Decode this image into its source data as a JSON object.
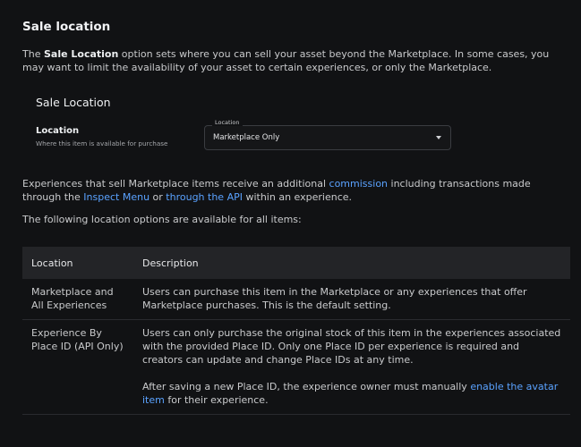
{
  "heading": "Sale location",
  "intro": {
    "prefix": "The ",
    "bold": "Sale Location",
    "suffix": " option sets where you can sell your asset beyond the Marketplace. In some cases, you may want to limit the availability of your asset to certain experiences, or only the Marketplace."
  },
  "card": {
    "title": "Sale Location",
    "location_label": "Location",
    "location_sub": "Where this item is available for purchase",
    "select_float_label": "Location",
    "select_value": "Marketplace Only"
  },
  "commission_para": {
    "t1": "Experiences that sell Marketplace items receive an additional ",
    "link1": "commission",
    "t2": " including transactions made through the ",
    "link2": "Inspect Menu",
    "t3": " or ",
    "link3": "through the API",
    "t4": " within an experience."
  },
  "options_intro": "The following location options are available for all items:",
  "table": {
    "headers": [
      "Location",
      "Description"
    ],
    "rows": [
      {
        "location": "Marketplace and All Experiences",
        "description": "Users can purchase this item in the Marketplace or any experiences that offer Marketplace purchases. This is the default setting."
      },
      {
        "location": "Experience By Place ID (API Only)",
        "description": "Users can only purchase the original stock of this item in the experiences associated with the provided Place ID. Only one Place ID per experience is required and creators can update and change Place IDs at any time.",
        "note_prefix": "After saving a new Place ID, the experience owner must manually ",
        "note_link": "enable the avatar item",
        "note_suffix": " for their experience."
      }
    ]
  },
  "colors": {
    "background": "#111214",
    "link": "#5aa2ff",
    "table_header": "#232427"
  }
}
